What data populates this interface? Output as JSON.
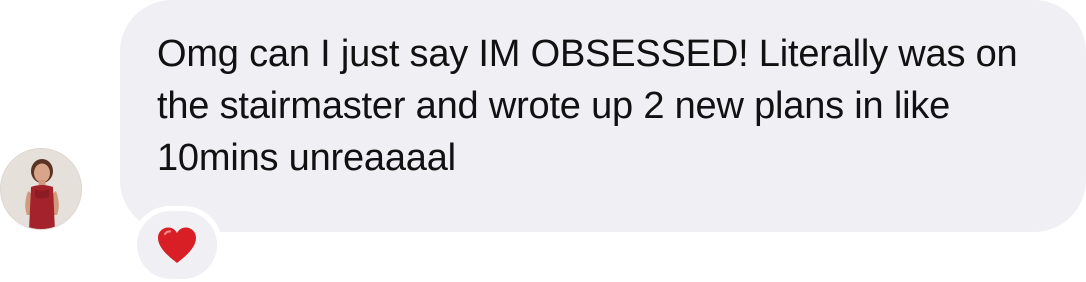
{
  "message": {
    "text": "Omg can I just say IM OBSESSED! Literally was on the stairmaster and wrote up 2 new plans in like 10mins unreaaaal",
    "reaction": "heart-emoji"
  },
  "sender": {
    "avatar": "profile-photo"
  },
  "colors": {
    "bubble": "#efeff4",
    "text": "#111111",
    "heart": "#d81f26"
  }
}
